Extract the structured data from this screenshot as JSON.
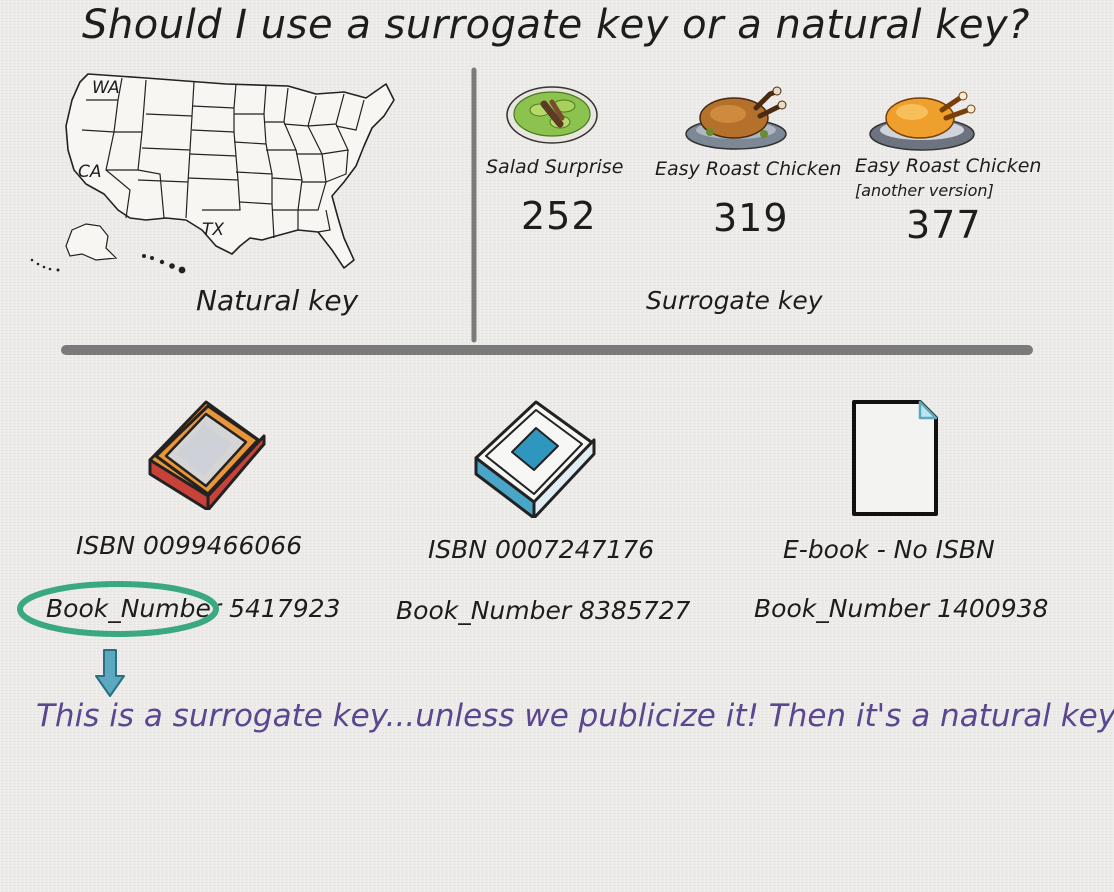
{
  "title": "Should I use a surrogate key or a natural key?",
  "natural_section": {
    "label": "Natural key",
    "state_labels": [
      "WA",
      "CA",
      "TX"
    ]
  },
  "surrogate_section": {
    "label": "Surrogate key",
    "dishes": [
      {
        "name": "Salad Surprise",
        "extra": "",
        "id": "252"
      },
      {
        "name": "Easy Roast Chicken",
        "extra": "",
        "id": "319"
      },
      {
        "name": "Easy Roast Chicken",
        "extra": "[another version]",
        "id": "377"
      }
    ]
  },
  "books": [
    {
      "isbn": "ISBN 0099466066",
      "book_number": "Book_Number 5417923",
      "icon": "red-book-icon"
    },
    {
      "isbn": "ISBN 0007247176",
      "book_number": "Book_Number 8385727",
      "icon": "blue-book-icon"
    },
    {
      "isbn": "E-book - No ISBN",
      "book_number": "Book_Number 1400938",
      "icon": "ebook-page-icon"
    }
  ],
  "note": "This is a surrogate key...unless we publicize it! Then it's a natural key.",
  "colors": {
    "highlight_circle": "#3aa882",
    "arrow": "#5aa9bf",
    "note": "#5b4690",
    "divider": "#7a7a7a"
  }
}
